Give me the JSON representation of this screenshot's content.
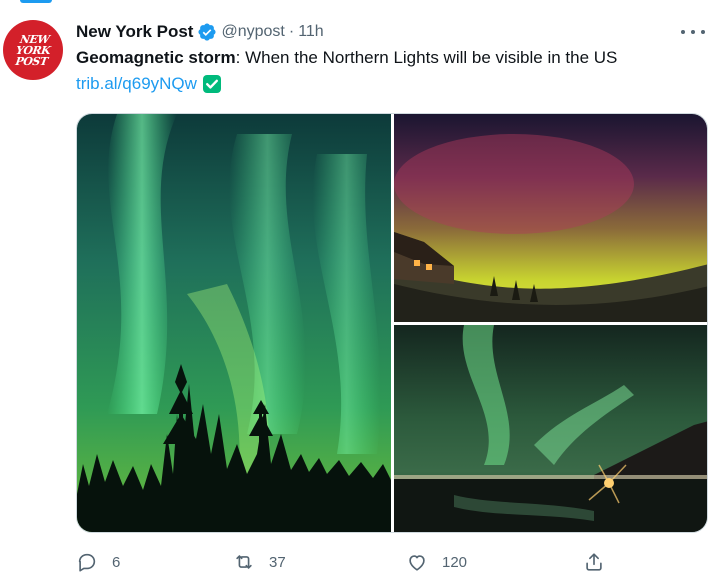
{
  "tweet": {
    "display_name": "New York Post",
    "handle": "@nypost",
    "separator": "·",
    "time": "11h",
    "avatar": {
      "line1": "NEW",
      "line2": "YORK",
      "line3": "POST",
      "color": "#d3202a"
    },
    "text_bold": "Geomagnetic storm",
    "text_rest": ": When the Northern Lights will be visible in the US",
    "link": "trib.al/q69yNQw",
    "accent_color": "#1d9bf0",
    "verified_color": "#1d9bf0",
    "check_color": "#00ba7c"
  },
  "actions": {
    "reply_count": "6",
    "retweet_count": "37",
    "like_count": "120"
  },
  "icons": [
    "verified-badge-icon",
    "check-mark-icon",
    "more-icon",
    "reply-icon",
    "retweet-icon",
    "like-icon",
    "share-icon"
  ]
}
